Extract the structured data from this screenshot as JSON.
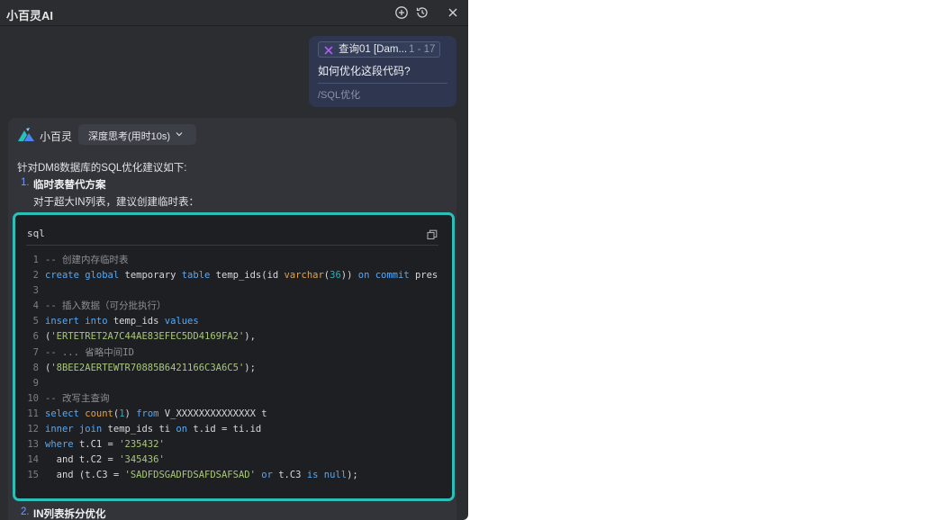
{
  "window": {
    "title": "小百灵AI",
    "actions": [
      {
        "name": "new-chat-icon"
      },
      {
        "name": "history-icon"
      },
      {
        "name": "close-icon"
      }
    ]
  },
  "user_message": {
    "context_chip": {
      "label": "查询01 [Dam...",
      "range": "1 - 17",
      "icon": "sql-file-icon"
    },
    "question": "如何优化这段代码?",
    "command": "/SQL优化"
  },
  "assistant": {
    "name": "小百灵",
    "think_button": "深度思考(用时10s)",
    "intro": "针对DM8数据库的SQL优化建议如下:",
    "items": [
      {
        "num": "1.",
        "title": "临时表替代方案",
        "desc": "对于超大IN列表，建议创建临时表："
      },
      {
        "num": "2.",
        "title": "IN列表拆分优化"
      }
    ],
    "code": {
      "language": "sql",
      "lines": [
        {
          "n": "1",
          "t": [
            {
              "k": "cm",
              "s": "-- 创建内存临时表"
            }
          ]
        },
        {
          "n": "2",
          "t": [
            {
              "k": "kw",
              "s": "create global "
            },
            {
              "k": "tx",
              "s": "temporary "
            },
            {
              "k": "kw",
              "s": "table "
            },
            {
              "k": "tx",
              "s": "temp_ids(id "
            },
            {
              "k": "fn",
              "s": "varchar"
            },
            {
              "k": "tx",
              "s": "("
            },
            {
              "k": "num",
              "s": "36"
            },
            {
              "k": "tx",
              "s": ")) "
            },
            {
              "k": "kw",
              "s": "on commit "
            },
            {
              "k": "tx",
              "s": "preserve"
            }
          ]
        },
        {
          "n": "3",
          "t": []
        },
        {
          "n": "4",
          "t": [
            {
              "k": "cm",
              "s": "-- 插入数据（可分批执行）"
            }
          ]
        },
        {
          "n": "5",
          "t": [
            {
              "k": "kw",
              "s": "insert into "
            },
            {
              "k": "tx",
              "s": "temp_ids "
            },
            {
              "k": "kw",
              "s": "values"
            }
          ]
        },
        {
          "n": "6",
          "t": [
            {
              "k": "tx",
              "s": "("
            },
            {
              "k": "str",
              "s": "'ERTETRET2A7C44AE83EFEC5DD4169FA2'"
            },
            {
              "k": "tx",
              "s": "),"
            }
          ]
        },
        {
          "n": "7",
          "t": [
            {
              "k": "cm",
              "s": "-- ... 省略中间ID"
            }
          ]
        },
        {
          "n": "8",
          "t": [
            {
              "k": "tx",
              "s": "("
            },
            {
              "k": "str",
              "s": "'8BEE2AERTEWTR70885B6421166C3A6C5'"
            },
            {
              "k": "tx",
              "s": ");"
            }
          ]
        },
        {
          "n": "9",
          "t": []
        },
        {
          "n": "10",
          "t": [
            {
              "k": "cm",
              "s": "-- 改写主查询"
            }
          ]
        },
        {
          "n": "11",
          "t": [
            {
              "k": "kw",
              "s": "select "
            },
            {
              "k": "fn",
              "s": "count"
            },
            {
              "k": "tx",
              "s": "("
            },
            {
              "k": "num",
              "s": "1"
            },
            {
              "k": "tx",
              "s": ") "
            },
            {
              "k": "kw",
              "s": "from "
            },
            {
              "k": "tx",
              "s": "V_XXXXXXXXXXXXXX t"
            }
          ]
        },
        {
          "n": "12",
          "t": [
            {
              "k": "kw",
              "s": "inner join "
            },
            {
              "k": "tx",
              "s": "temp_ids ti "
            },
            {
              "k": "kw",
              "s": "on "
            },
            {
              "k": "tx",
              "s": "t.id = ti.id"
            }
          ]
        },
        {
          "n": "13",
          "t": [
            {
              "k": "kw",
              "s": "where "
            },
            {
              "k": "tx",
              "s": "t.C1 = "
            },
            {
              "k": "str",
              "s": "'235432'"
            }
          ]
        },
        {
          "n": "14",
          "t": [
            {
              "k": "tx",
              "s": "  and t.C2 = "
            },
            {
              "k": "str",
              "s": "'345436'"
            }
          ]
        },
        {
          "n": "15",
          "t": [
            {
              "k": "tx",
              "s": "  and (t.C3 = "
            },
            {
              "k": "str",
              "s": "'SADFDSGADFDSAFDSAFSAD'"
            },
            {
              "k": "tx",
              "s": " "
            },
            {
              "k": "kw",
              "s": "or "
            },
            {
              "k": "tx",
              "s": "t.C3 "
            },
            {
              "k": "kw",
              "s": "is null"
            },
            {
              "k": "tx",
              "s": ");"
            }
          ]
        }
      ]
    }
  },
  "colors": {
    "panel_bg": "#2b2d30",
    "accent_teal": "#2bbfb8",
    "keyword": "#56a8f5",
    "string": "#a9c77a",
    "comment": "#8c8f96",
    "function": "#e0a34a",
    "list_number": "#6e9cff"
  }
}
